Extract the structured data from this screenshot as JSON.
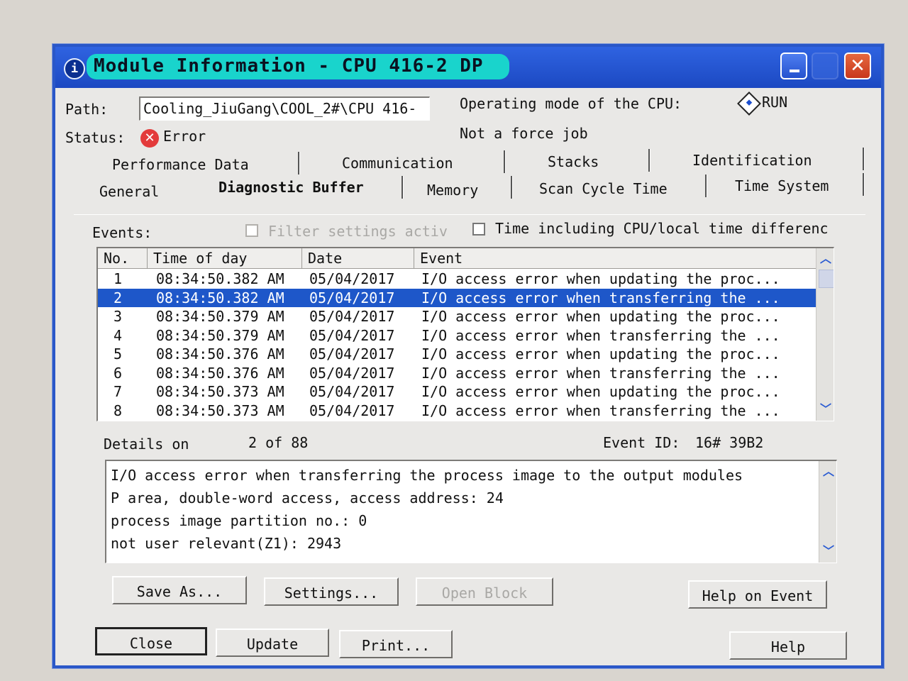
{
  "window": {
    "title": "Module Information - CPU 416-2 DP",
    "app_icon": "info-icon",
    "controls": {
      "minimize": "minimize-icon",
      "maximize": "maximize-icon",
      "close_glyph": "✕"
    }
  },
  "header": {
    "path_label": "Path:",
    "path_value": "Cooling_JiuGang\\COOL_2#\\CPU 416-",
    "opmode_label": "Operating mode of the  CPU:",
    "opmode_value": "RUN",
    "status_label": "Status:",
    "status_value": "Error",
    "force_job": "Not a force job"
  },
  "tabs": {
    "row1": [
      "Performance Data",
      "Communication",
      "Stacks",
      "Identification"
    ],
    "row2": [
      "General",
      "Diagnostic Buffer",
      "Memory",
      "Scan Cycle Time",
      "Time System"
    ],
    "active": "Diagnostic Buffer"
  },
  "events": {
    "label": "Events:",
    "filter_label": "Filter settings activ",
    "time_label": "Time including CPU/local time differenc",
    "columns": [
      "No.",
      "Time of day",
      "Date",
      "Event"
    ],
    "rows": [
      {
        "no": "1",
        "time": "08:34:50.382 AM",
        "date": "05/04/2017",
        "event": "I/O access error when updating the proc..."
      },
      {
        "no": "2",
        "time": "08:34:50.382 AM",
        "date": "05/04/2017",
        "event": "I/O access error when transferring the ..."
      },
      {
        "no": "3",
        "time": "08:34:50.379 AM",
        "date": "05/04/2017",
        "event": "I/O access error when updating the proc..."
      },
      {
        "no": "4",
        "time": "08:34:50.379 AM",
        "date": "05/04/2017",
        "event": "I/O access error when transferring the ..."
      },
      {
        "no": "5",
        "time": "08:34:50.376 AM",
        "date": "05/04/2017",
        "event": "I/O access error when updating the proc..."
      },
      {
        "no": "6",
        "time": "08:34:50.376 AM",
        "date": "05/04/2017",
        "event": "I/O access error when transferring the ..."
      },
      {
        "no": "7",
        "time": "08:34:50.373 AM",
        "date": "05/04/2017",
        "event": "I/O access error when updating the proc..."
      },
      {
        "no": "8",
        "time": "08:34:50.373 AM",
        "date": "05/04/2017",
        "event": "I/O access error when transferring the ..."
      }
    ],
    "selected": "2"
  },
  "details": {
    "label": "Details on",
    "position": "2 of 88",
    "event_id_label": "Event ID:",
    "event_id_value": "16# 39B2",
    "lines": [
      "I/O access error when transferring the process image to the output modules",
      "P area, double-word access, access address:      24",
      "process image partition no.:   0",
      "not user relevant(Z1): 2943"
    ]
  },
  "buttons": {
    "save_as": "Save As...",
    "settings": "Settings...",
    "open_block": "Open Block",
    "help_on_event": "Help on Event",
    "close": "Close",
    "update": "Update",
    "print": "Print...",
    "help": "Help"
  }
}
